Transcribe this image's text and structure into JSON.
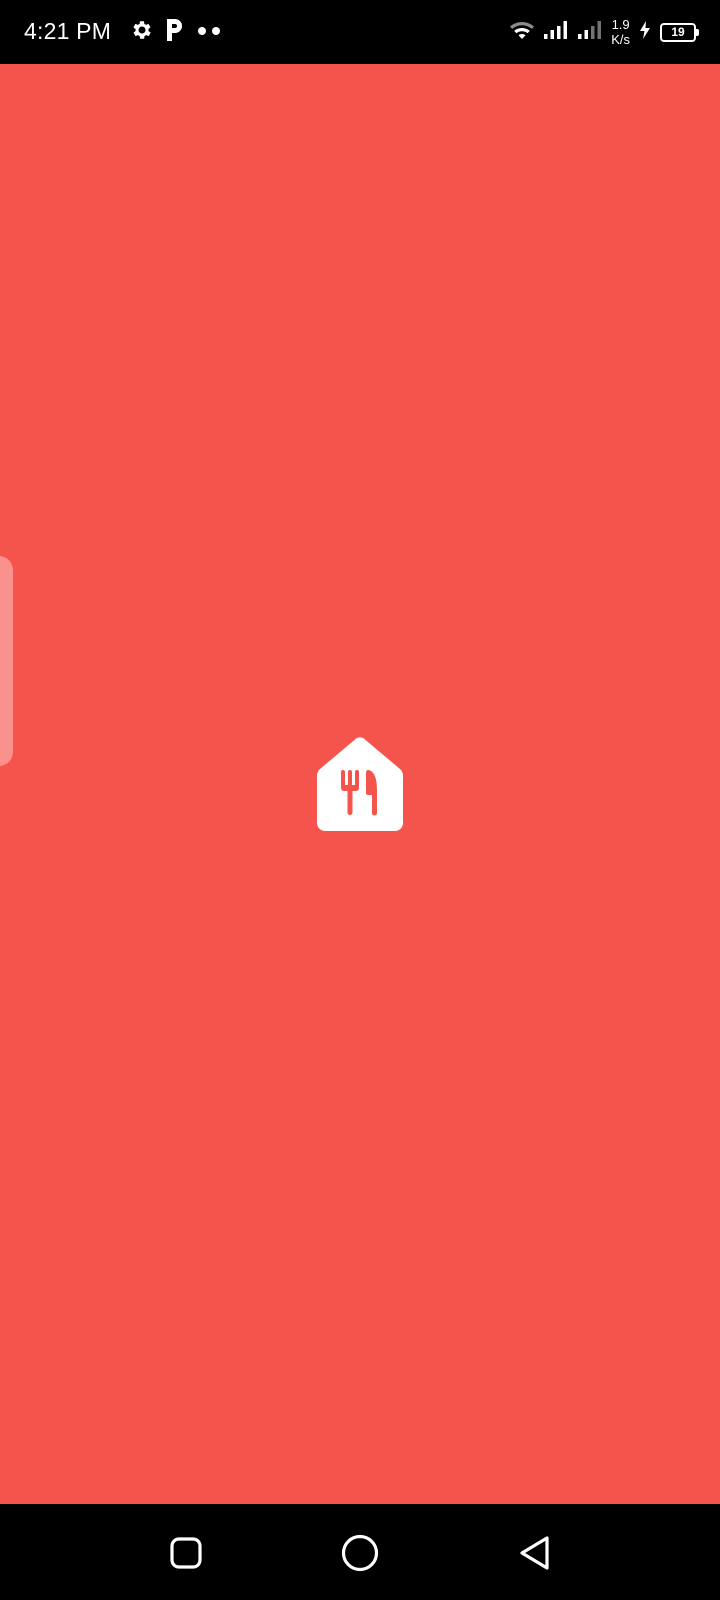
{
  "status_bar": {
    "time": "4:21 PM",
    "icons": [
      "gear-icon",
      "p-icon",
      "dots-icon",
      "wifi-icon",
      "signal-icon",
      "signal-icon-2",
      "charging-icon"
    ],
    "net_speed_value": "1.9",
    "net_speed_unit": "K/s",
    "battery_level": "19"
  },
  "app": {
    "background_color": "#f5544d",
    "logo_icon": "restaurant-house-icon"
  },
  "nav_bar": {
    "buttons": [
      "recents-icon",
      "home-icon",
      "back-icon"
    ]
  }
}
